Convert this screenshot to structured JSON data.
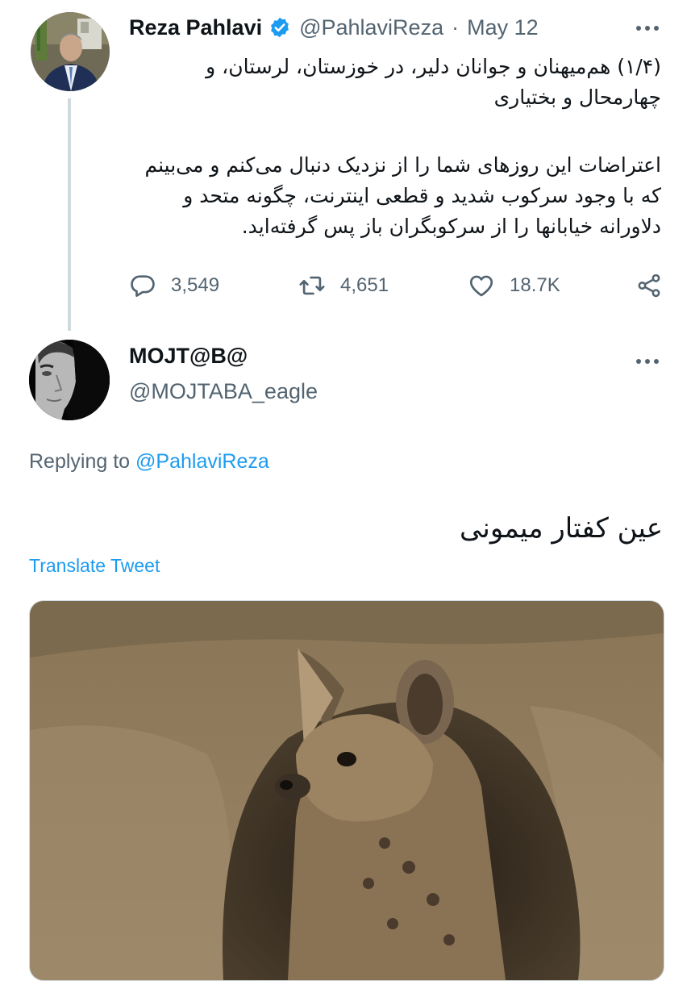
{
  "tweet1": {
    "author_name": "Reza Pahlavi",
    "handle": "@PahlaviReza",
    "separator": "·",
    "date": "May 12",
    "verified": true,
    "text_line1": "(۱/۴) هم‌میهنان و جوانان دلیر، در خوزستان، لرستان، و چهارمحال و بختیاری",
    "text_line2": "اعتراضات این روزهای شما را از نزدیک دنبال می‌کنم و می‌بینم که با وجود سرکوب شدید و قطعی اینترنت، چگونه متحد و دلاورانه خیابانها را از سرکوبگران باز پس گرفته‌اید.",
    "reply_count": "3,549",
    "retweet_count": "4,651",
    "like_count": "18.7K",
    "icons": [
      "verified-badge-icon",
      "more-icon",
      "reply-icon",
      "retweet-icon",
      "like-icon",
      "share-icon"
    ]
  },
  "tweet2": {
    "author_name": "MOJT@B@",
    "handle": "@MOJTABA_eagle",
    "replying_prefix": "Replying to",
    "replying_handle": "@PahlaviReza",
    "text": "عین کفتار میمونی",
    "translate_label": "Translate Tweet",
    "icons": [
      "more-icon"
    ]
  },
  "colors": {
    "text_primary": "#0f1419",
    "text_secondary": "#536471",
    "accent": "#1d9bf0",
    "thread_line": "#cfd9de"
  }
}
